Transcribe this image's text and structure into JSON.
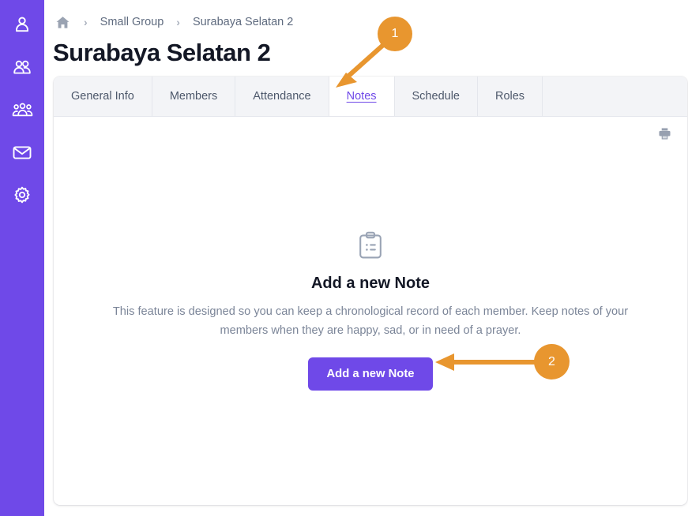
{
  "app": {
    "accent_purple": "#6F49E8",
    "annotation_orange": "#E8962F",
    "page_background": "#FFFFFF",
    "tabbar_background": "#F3F4F7",
    "muted_text": "#7B8598"
  },
  "sidebar": {
    "items": [
      {
        "icon": "person-icon",
        "label": "Profile"
      },
      {
        "icon": "two-people-icon",
        "label": "People"
      },
      {
        "icon": "group-people-icon",
        "label": "Groups"
      },
      {
        "icon": "envelope-icon",
        "label": "Messages"
      },
      {
        "icon": "gear-icon",
        "label": "Settings"
      }
    ]
  },
  "breadcrumb": {
    "home_icon": "home-icon",
    "separator": "›",
    "items": [
      {
        "label": "Small Group"
      },
      {
        "label": "Surabaya Selatan 2"
      }
    ]
  },
  "header": {
    "title": "Surabaya Selatan 2"
  },
  "tabs": [
    {
      "label": "General Info",
      "active": false
    },
    {
      "label": "Members",
      "active": false
    },
    {
      "label": "Attendance",
      "active": false
    },
    {
      "label": "Notes",
      "active": true
    },
    {
      "label": "Schedule",
      "active": false
    },
    {
      "label": "Roles",
      "active": false
    }
  ],
  "toolbar": {
    "print_icon": "printer-icon"
  },
  "empty_state": {
    "icon": "clipboard-list-icon",
    "title": "Add a new Note",
    "description": "This feature is designed so you can keep a chronological record of each member. Keep notes of your members when they are happy, sad, or in need of a prayer.",
    "button_label": "Add a new Note"
  },
  "annotations": [
    {
      "number": "1",
      "points_to": "Notes tab"
    },
    {
      "number": "2",
      "points_to": "Add a new Note button"
    }
  ]
}
